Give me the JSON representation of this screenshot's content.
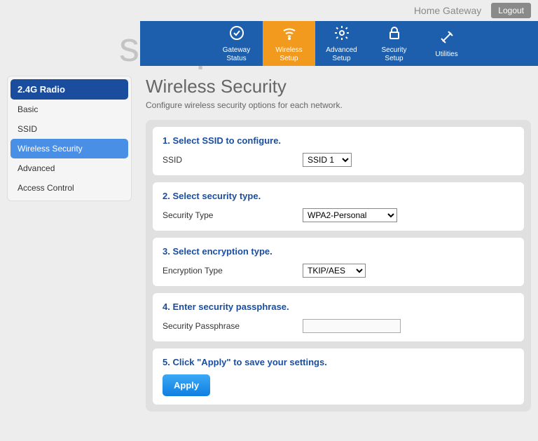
{
  "watermark": "setuprouter",
  "header": {
    "title": "Home Gateway",
    "logout": "Logout"
  },
  "nav": {
    "items": [
      {
        "label1": "Gateway",
        "label2": "Status"
      },
      {
        "label1": "Wireless",
        "label2": "Setup"
      },
      {
        "label1": "Advanced",
        "label2": "Setup"
      },
      {
        "label1": "Security",
        "label2": "Setup"
      },
      {
        "label1": "Utilities",
        "label2": ""
      }
    ]
  },
  "sidebar": {
    "header": "2.4G Radio",
    "items": [
      {
        "label": "Basic"
      },
      {
        "label": "SSID"
      },
      {
        "label": "Wireless Security"
      },
      {
        "label": "Advanced"
      },
      {
        "label": "Access Control"
      }
    ]
  },
  "page": {
    "title": "Wireless Security",
    "subtitle": "Configure wireless security options for each network."
  },
  "cards": {
    "c1": {
      "title": "1. Select SSID to configure.",
      "label": "SSID",
      "value": "SSID 1"
    },
    "c2": {
      "title": "2. Select security type.",
      "label": "Security Type",
      "value": "WPA2-Personal"
    },
    "c3": {
      "title": "3. Select encryption type.",
      "label": "Encryption Type",
      "value": "TKIP/AES"
    },
    "c4": {
      "title": "4. Enter security passphrase.",
      "label": "Security Passphrase",
      "value": ""
    },
    "c5": {
      "title": "5. Click \"Apply\" to save your settings.",
      "button": "Apply"
    }
  }
}
